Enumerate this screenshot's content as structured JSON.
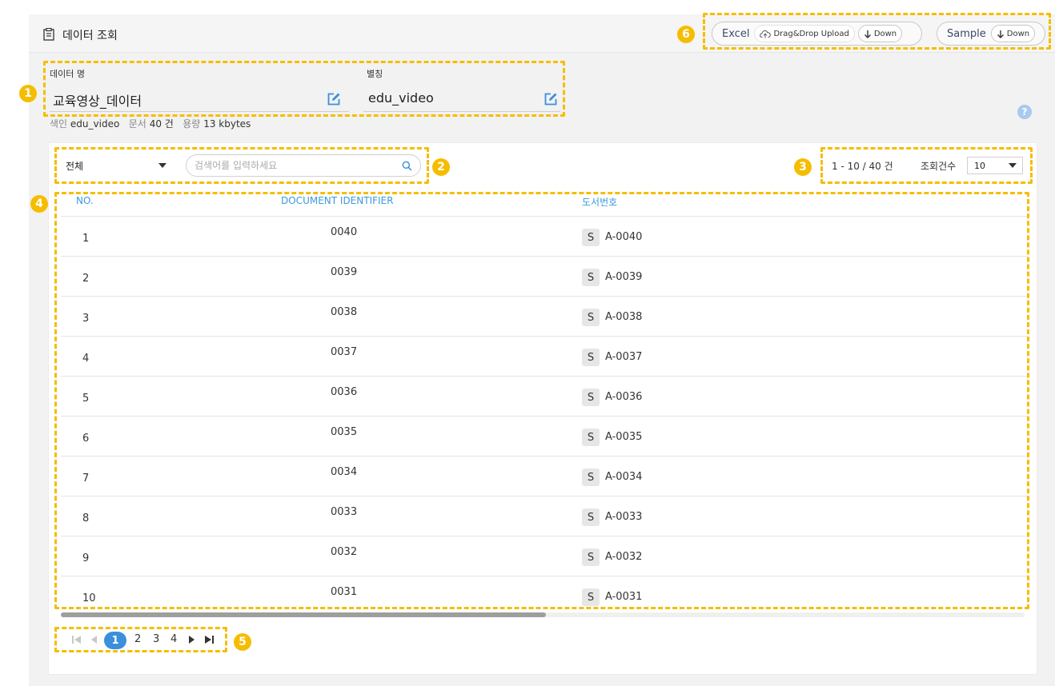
{
  "header": {
    "title": "데이터 조회",
    "excel_label": "Excel",
    "upload_label": "Drag&Drop Upload",
    "down_label": "Down",
    "sample_label": "Sample",
    "sample_down_label": "Down"
  },
  "dataset": {
    "name_label": "데이터 명",
    "name_value": "교육영상_데이터",
    "alias_label": "별칭",
    "alias_value": "edu_video",
    "meta_index_label": "색인",
    "meta_index_value": "edu_video",
    "meta_docs_label": "문서",
    "meta_docs_value": "40 건",
    "meta_size_label": "용량",
    "meta_size_value": "13 kbytes"
  },
  "help": "?",
  "toolbar": {
    "filter_value": "전체",
    "search_placeholder": "검색어를 입력하세요",
    "count_text": "1 - 10 / 40 건",
    "rows_label": "조회건수",
    "rows_value": "10"
  },
  "table": {
    "columns": [
      "NO.",
      "DOCUMENT IDENTIFIER",
      "도서번호"
    ],
    "rows": [
      {
        "no": "1",
        "doc": "0040",
        "badge": "S",
        "book": "A-0040"
      },
      {
        "no": "2",
        "doc": "0039",
        "badge": "S",
        "book": "A-0039"
      },
      {
        "no": "3",
        "doc": "0038",
        "badge": "S",
        "book": "A-0038"
      },
      {
        "no": "4",
        "doc": "0037",
        "badge": "S",
        "book": "A-0037"
      },
      {
        "no": "5",
        "doc": "0036",
        "badge": "S",
        "book": "A-0036"
      },
      {
        "no": "6",
        "doc": "0035",
        "badge": "S",
        "book": "A-0035"
      },
      {
        "no": "7",
        "doc": "0034",
        "badge": "S",
        "book": "A-0034"
      },
      {
        "no": "8",
        "doc": "0033",
        "badge": "S",
        "book": "A-0033"
      },
      {
        "no": "9",
        "doc": "0032",
        "badge": "S",
        "book": "A-0032"
      },
      {
        "no": "10",
        "doc": "0031",
        "badge": "S",
        "book": "A-0031"
      }
    ]
  },
  "pagination": {
    "current": "1",
    "pages": [
      "2",
      "3",
      "4"
    ]
  },
  "markers": [
    "1",
    "2",
    "3",
    "4",
    "5",
    "6"
  ],
  "colors": {
    "annotation": "#f5bd00",
    "accent_blue": "#3a9ad9",
    "page_current": "#3b8fdb"
  },
  "icons": [
    "clipboard-icon",
    "edit-icon",
    "help-icon",
    "search-icon",
    "cloud-upload-icon",
    "arrow-down-icon",
    "first-page-icon",
    "prev-page-icon",
    "next-page-icon",
    "last-page-icon"
  ]
}
